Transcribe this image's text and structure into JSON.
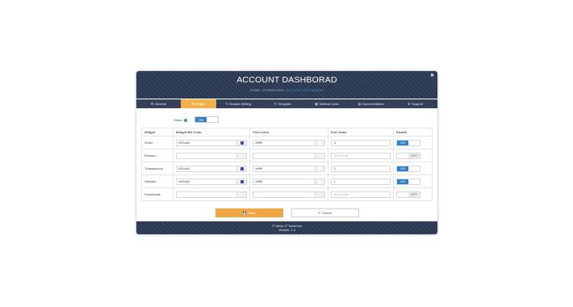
{
  "header": {
    "title": "ACCOUNT DASHBORAD",
    "breadcrumb": {
      "home": "HOME",
      "sep1": " › ",
      "section": "EXTENSIONS",
      "sep2": " › ",
      "current": "ACCOUNT DASHBORAD"
    },
    "close": "✖"
  },
  "tabs": [
    {
      "icon": "⚙",
      "label": "General"
    },
    {
      "icon": "⊞",
      "label": "Widget"
    },
    {
      "icon": "✎",
      "label": "Module Setting"
    },
    {
      "icon": "✎",
      "label": "Template"
    },
    {
      "icon": "▦",
      "label": "Sidebar Links"
    },
    {
      "icon": "▤",
      "label": "Documentation"
    },
    {
      "icon": "⊕",
      "label": "Support"
    }
  ],
  "status": {
    "label": "Status",
    "toggle_on": "ON"
  },
  "table": {
    "headers": [
      "Widget",
      "Widget BG Color",
      "Font Color",
      "Sort Order",
      "Enable"
    ],
    "sort_placeholder": "Sort Order",
    "rows": [
      {
        "name": "Order",
        "bg": "#3f4da2",
        "font": "#ffffff",
        "sort": "3",
        "enable": "ON"
      },
      {
        "name": "Reward",
        "bg": "",
        "font": "",
        "sort": "",
        "enable": "OFF"
      },
      {
        "name": "Transactions",
        "bg": "#3f4da2",
        "font": "#ffffff",
        "sort": "2",
        "enable": "ON"
      },
      {
        "name": "Wishlist",
        "bg": "#3f4da2",
        "font": "#ffffff",
        "sort": "1",
        "enable": "ON"
      },
      {
        "name": "Downloads",
        "bg": "",
        "font": "",
        "sort": "",
        "enable": "OFF"
      }
    ]
  },
  "actions": {
    "save_icon": "💾",
    "save": "Save",
    "cancel_icon": "↶",
    "cancel": "Cancel"
  },
  "footer": {
    "line1": "© Webx-IT Solutions",
    "line2": "Version: 1.0"
  },
  "colors": {
    "header_bg": "#2b3a55",
    "tab_active": "#f1b04a",
    "toggle_on": "#2f80c6",
    "save_button": "#f0a743",
    "swatch_blue": "#3f4da2"
  }
}
